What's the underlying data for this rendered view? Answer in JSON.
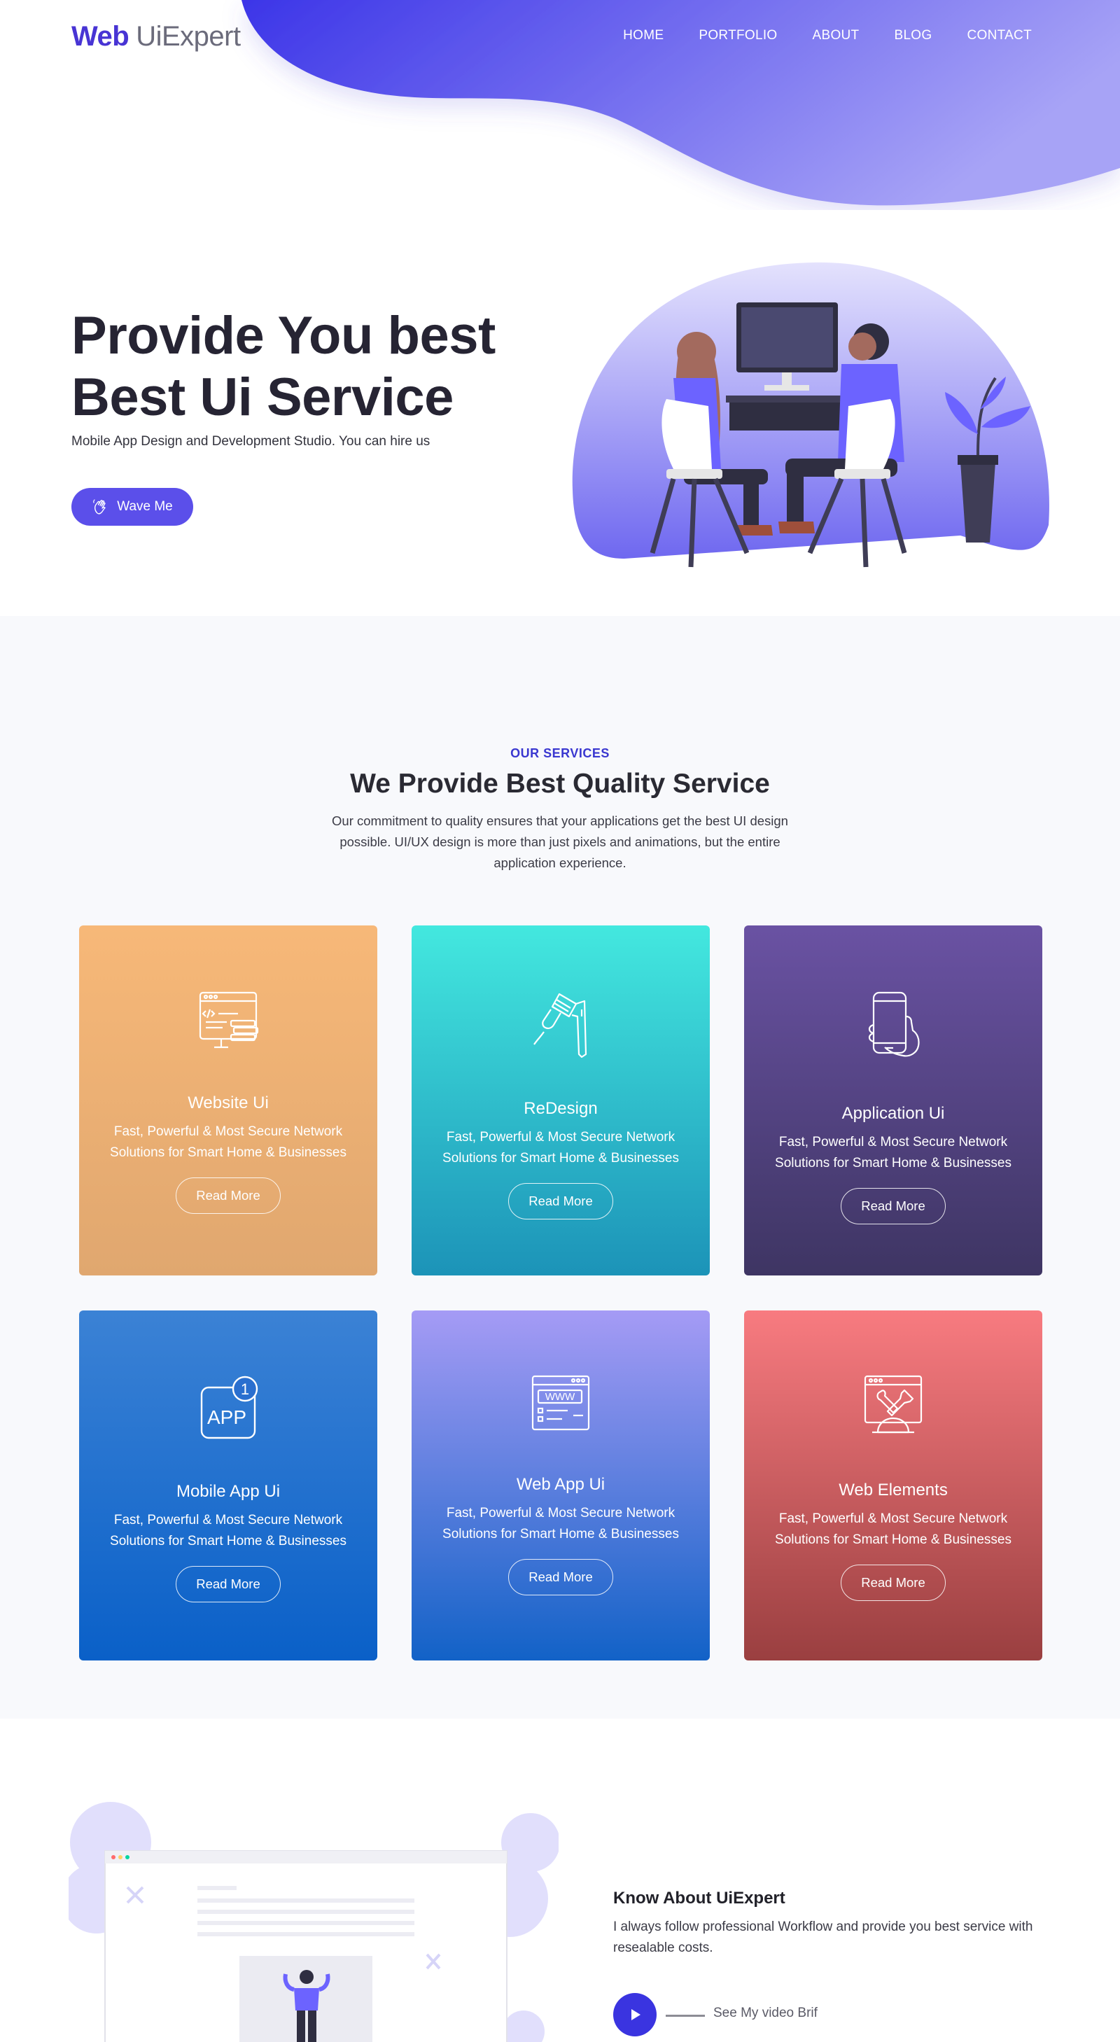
{
  "brand": {
    "bold": "Web",
    "light": "UiExpert"
  },
  "nav": [
    "HOME",
    "PORTFOLIO",
    "ABOUT",
    "BLOG",
    "CONTACT"
  ],
  "hero": {
    "title_line1": "Provide You best",
    "title_line2": "Best Ui Service",
    "subtitle": "Mobile App Design and Development Studio. You can hire us",
    "button": "Wave Me"
  },
  "services": {
    "eyebrow": "OUR SERVICES",
    "title": "We Provide Best Quality Service",
    "text": "Our commitment to quality ensures that your applications get the best UI design possible. UI/UX design is more than just pixels and animations, but the entire application experience.",
    "cards": [
      {
        "title": "Website Ui",
        "text": "Fast, Powerful & Most Secure Network Solutions for Smart Home & Businesses",
        "button": "Read More",
        "icon": "code-window-icon"
      },
      {
        "title": "ReDesign",
        "text": "Fast, Powerful & Most Secure Network Solutions for Smart Home & Businesses",
        "button": "Read More",
        "icon": "paint-brush-icon"
      },
      {
        "title": "Application Ui",
        "text": "Fast, Powerful & Most Secure Network Solutions for Smart Home & Businesses",
        "button": "Read More",
        "icon": "phone-hand-icon"
      },
      {
        "title": "Mobile App Ui",
        "text": "Fast, Powerful & Most Secure Network Solutions for Smart Home & Businesses",
        "button": "Read More",
        "icon": "app-badge-icon",
        "icon_text": "APP",
        "badge": "1"
      },
      {
        "title": "Web App Ui",
        "text": "Fast, Powerful & Most Secure Network Solutions for Smart Home & Businesses",
        "button": "Read More",
        "icon": "www-window-icon",
        "icon_text": "WWW"
      },
      {
        "title": "Web Elements",
        "text": "Fast, Powerful & Most Secure Network Solutions for Smart Home & Businesses",
        "button": "Read More",
        "icon": "tools-window-icon"
      }
    ]
  },
  "about": {
    "title": "Know About UiExpert",
    "text": "I always follow professional Workflow and provide you best service with resealable costs.",
    "video_label": "See My video Brif"
  },
  "colors": {
    "accent": "#3a37d0",
    "button": "#5b4fea",
    "blob_start": "#3c35e8",
    "blob_end": "#a7a3f6"
  }
}
